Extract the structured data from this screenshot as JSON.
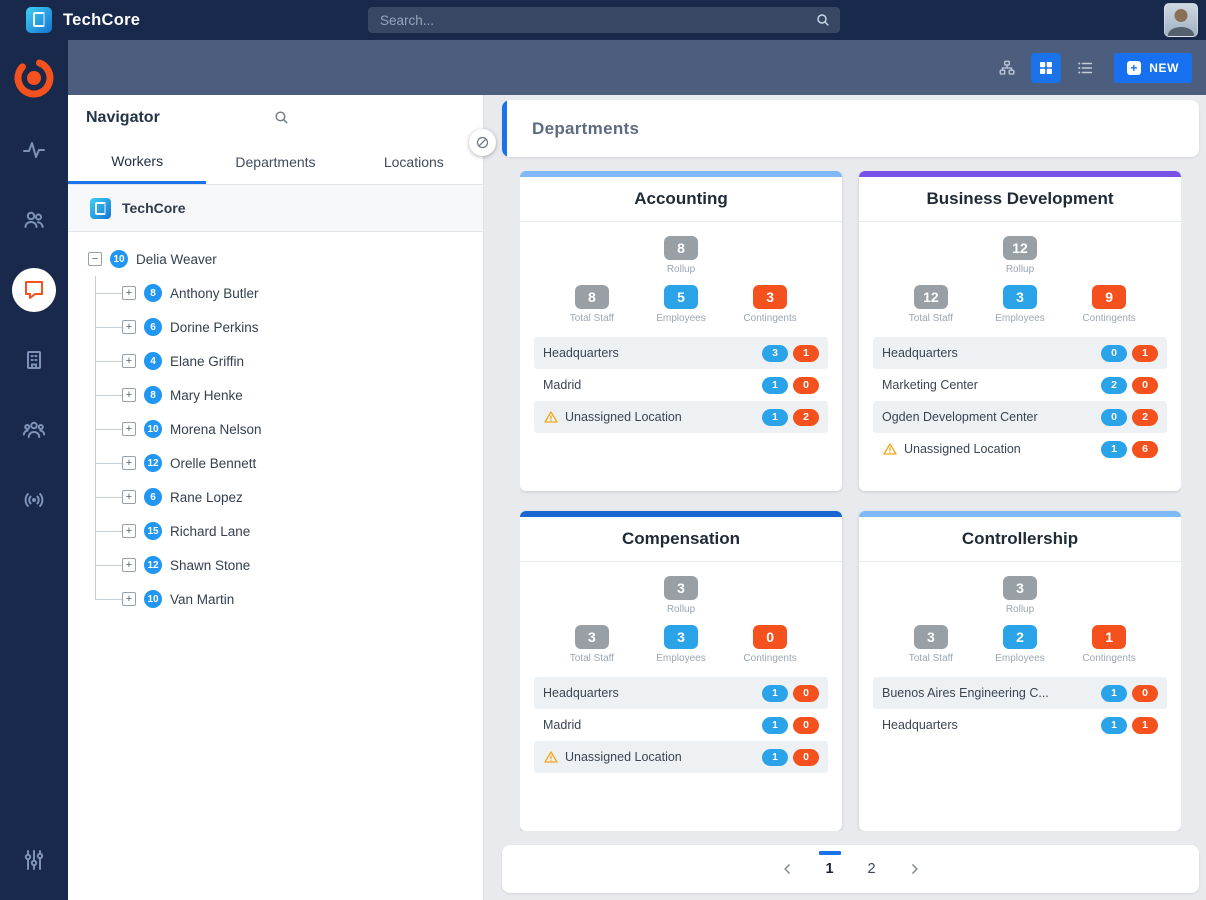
{
  "topbar": {
    "brand": "TechCore",
    "search_placeholder": "Search..."
  },
  "toolbar": {
    "new_label": "NEW"
  },
  "navigator": {
    "title": "Navigator",
    "tabs": [
      {
        "label": "Workers",
        "active": true
      },
      {
        "label": "Departments",
        "active": false
      },
      {
        "label": "Locations",
        "active": false
      }
    ],
    "company": "TechCore",
    "root": {
      "name": "Delia Weaver",
      "count": "10",
      "expanded": true
    },
    "children": [
      {
        "name": "Anthony Butler",
        "count": "8"
      },
      {
        "name": "Dorine Perkins",
        "count": "6"
      },
      {
        "name": "Elane Griffin",
        "count": "4"
      },
      {
        "name": "Mary Henke",
        "count": "8"
      },
      {
        "name": "Morena Nelson",
        "count": "10"
      },
      {
        "name": "Orelle Bennett",
        "count": "12"
      },
      {
        "name": "Rane Lopez",
        "count": "6"
      },
      {
        "name": "Richard Lane",
        "count": "15"
      },
      {
        "name": "Shawn Stone",
        "count": "12"
      },
      {
        "name": "Van Martin",
        "count": "10"
      }
    ]
  },
  "main": {
    "title": "Departments",
    "accent_color": "#1a73e8",
    "stat_labels": {
      "rollup": "Rollup",
      "total_staff": "Total Staff",
      "employees": "Employees",
      "contingents": "Contingents"
    },
    "cards": [
      {
        "title": "Accounting",
        "accent": "#80b7f4",
        "rollup": "8",
        "total_staff": "8",
        "employees": "5",
        "contingents": "3",
        "locations": [
          {
            "name": "Headquarters",
            "employees": "3",
            "contingents": "1",
            "warning": false
          },
          {
            "name": "Madrid",
            "employees": "1",
            "contingents": "0",
            "warning": false
          },
          {
            "name": "Unassigned Location",
            "employees": "1",
            "contingents": "2",
            "warning": true
          }
        ]
      },
      {
        "title": "Business Development",
        "accent": "#7653e6",
        "rollup": "12",
        "total_staff": "12",
        "employees": "3",
        "contingents": "9",
        "locations": [
          {
            "name": "Headquarters",
            "employees": "0",
            "contingents": "1",
            "warning": false
          },
          {
            "name": "Marketing Center",
            "employees": "2",
            "contingents": "0",
            "warning": false
          },
          {
            "name": "Ogden Development Center",
            "employees": "0",
            "contingents": "2",
            "warning": false
          },
          {
            "name": "Unassigned Location",
            "employees": "1",
            "contingents": "6",
            "warning": true
          }
        ]
      },
      {
        "title": "Compensation",
        "accent": "#1a66d0",
        "rollup": "3",
        "total_staff": "3",
        "employees": "3",
        "contingents": "0",
        "locations": [
          {
            "name": "Headquarters",
            "employees": "1",
            "contingents": "0",
            "warning": false
          },
          {
            "name": "Madrid",
            "employees": "1",
            "contingents": "0",
            "warning": false
          },
          {
            "name": "Unassigned Location",
            "employees": "1",
            "contingents": "0",
            "warning": true
          }
        ]
      },
      {
        "title": "Controllership",
        "accent": "#7fb9f6",
        "rollup": "3",
        "total_staff": "3",
        "employees": "2",
        "contingents": "1",
        "locations": [
          {
            "name": "Buenos Aires Engineering C...",
            "employees": "1",
            "contingents": "0",
            "warning": false
          },
          {
            "name": "Headquarters",
            "employees": "1",
            "contingents": "1",
            "warning": false
          }
        ]
      }
    ],
    "pagination": {
      "pages": [
        "1",
        "2"
      ],
      "active": "1"
    }
  },
  "sidebar": {
    "icons": [
      "company-logo",
      "activity",
      "people",
      "messages",
      "building",
      "team",
      "broadcast",
      "filters"
    ],
    "active_icon": "messages"
  }
}
